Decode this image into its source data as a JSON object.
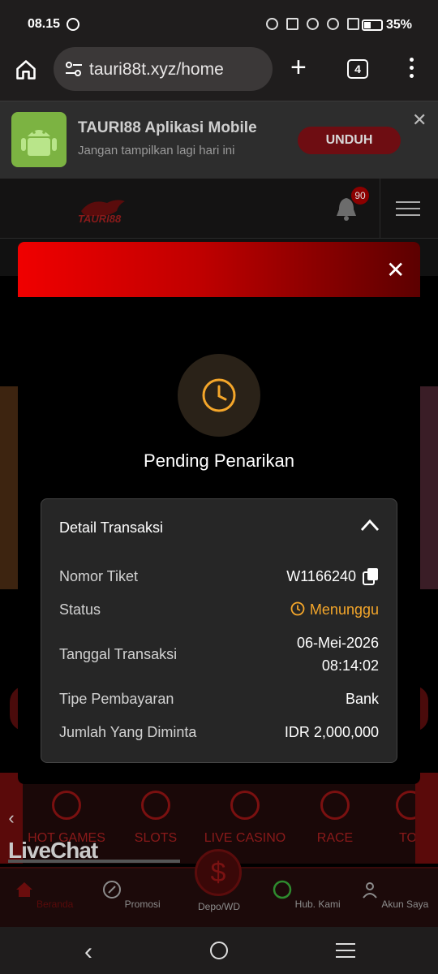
{
  "status_bar": {
    "time": "08.15",
    "battery": "35%"
  },
  "browser": {
    "url": "tauri88t.xyz/home",
    "tab_count": "4"
  },
  "app_banner": {
    "title": "TAURI88 Aplikasi Mobile",
    "subtitle": "Jangan tampilkan lagi hari ini",
    "download_label": "UNDUH"
  },
  "site_header": {
    "logo_text": "TAURI88",
    "notification_count": "90"
  },
  "modal": {
    "title": "Pending Penarikan",
    "detail": {
      "heading": "Detail Transaksi",
      "rows": [
        {
          "label": "Nomor Tiket",
          "value": "W1166240"
        },
        {
          "label": "Status",
          "value": "Menunggu"
        },
        {
          "label": "Tanggal Transaksi",
          "value_line1": "06-Mei-2026",
          "value_line2": "08:14:02"
        },
        {
          "label": "Tipe Pembayaran",
          "value": "Bank"
        },
        {
          "label": "Jumlah Yang Diminta",
          "value": "IDR 2,000,000"
        }
      ]
    }
  },
  "game_categories": [
    "HOT GAMES",
    "SLOTS",
    "LIVE CASINO",
    "RACE",
    "TO"
  ],
  "livechat_label": "LiveChat",
  "bottom_nav": [
    {
      "label": "Beranda",
      "icon": "home-icon"
    },
    {
      "label": "Promosi",
      "icon": "percent-icon"
    },
    {
      "label": "Depo/WD",
      "icon": "dollar-icon"
    },
    {
      "label": "Hub. Kami",
      "icon": "support-icon"
    },
    {
      "label": "Akun Saya",
      "icon": "user-icon"
    }
  ],
  "colors": {
    "accent_red": "#e00000",
    "pending_orange": "#f4a62a"
  }
}
